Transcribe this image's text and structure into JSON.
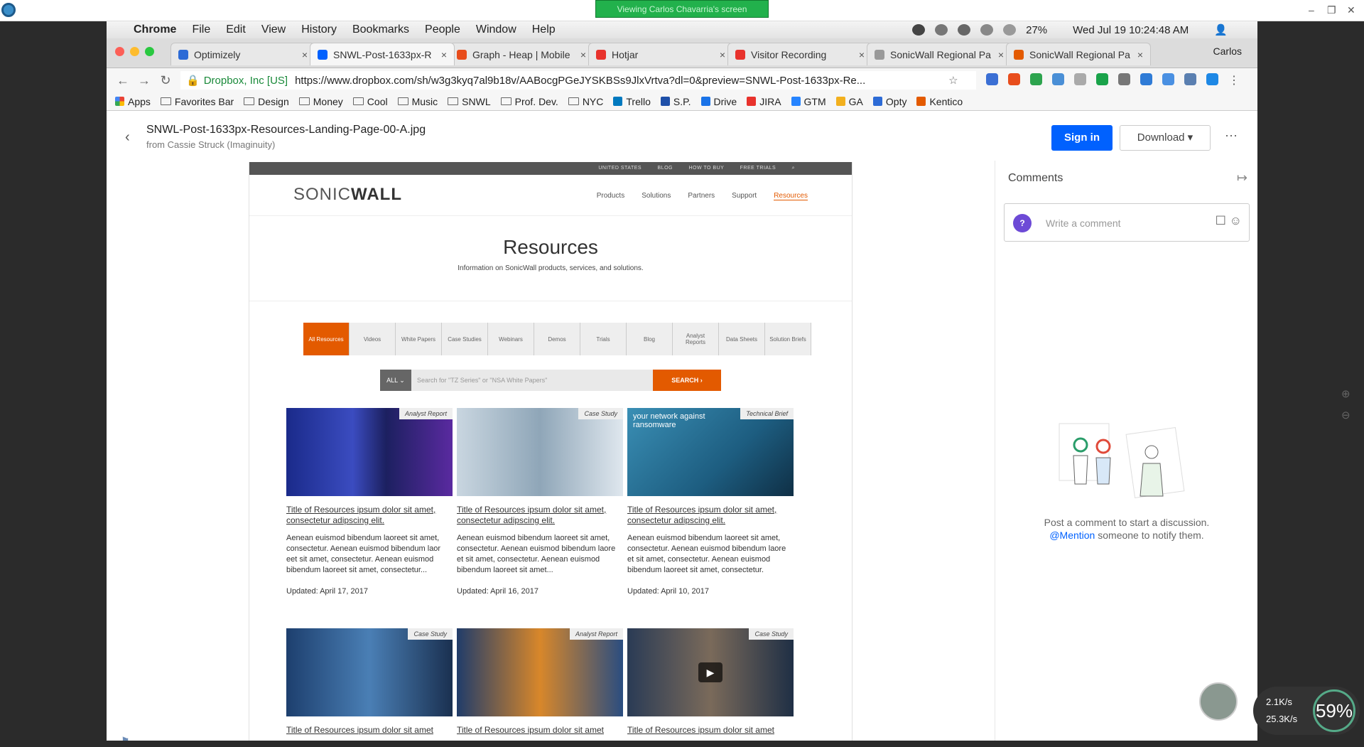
{
  "share_banner": "Viewing Carlos Chavarria's screen",
  "mac_menu": {
    "app": "Chrome",
    "items": [
      "File",
      "Edit",
      "View",
      "History",
      "Bookmarks",
      "People",
      "Window",
      "Help"
    ],
    "battery": "27%",
    "clock": "Wed Jul 19  10:24:48 AM"
  },
  "tabs": [
    {
      "title": "Optimizely",
      "color": "#2d6bd6"
    },
    {
      "title": "SNWL-Post-1633px-R",
      "color": "#0061fe"
    },
    {
      "title": "Graph - Heap | Mobile",
      "color": "#e84d1c"
    },
    {
      "title": "Hotjar",
      "color": "#e8322c"
    },
    {
      "title": "Visitor Recording",
      "color": "#e8322c"
    },
    {
      "title": "SonicWall Regional Pa",
      "color": "#999999"
    },
    {
      "title": "SonicWall Regional Pa",
      "color": "#e35a00"
    }
  ],
  "profile_name": "Carlos",
  "omnibox": {
    "secure_label": "Dropbox, Inc [US]",
    "url": "https://www.dropbox.com/sh/w3g3kyq7al9b18v/AABocgPGeJYSKBSs9JlxVrtva?dl=0&preview=SNWL-Post-1633px-Re..."
  },
  "bookmarks": [
    {
      "label": "Apps",
      "type": "apps"
    },
    {
      "label": "Favorites Bar",
      "type": "folder"
    },
    {
      "label": "Design",
      "type": "folder"
    },
    {
      "label": "Money",
      "type": "folder"
    },
    {
      "label": "Cool",
      "type": "folder"
    },
    {
      "label": "Music",
      "type": "folder"
    },
    {
      "label": "SNWL",
      "type": "folder"
    },
    {
      "label": "Prof. Dev.",
      "type": "folder"
    },
    {
      "label": "NYC",
      "type": "folder"
    },
    {
      "label": "Trello",
      "type": "link"
    },
    {
      "label": "S.P.",
      "type": "link"
    },
    {
      "label": "Drive",
      "type": "link"
    },
    {
      "label": "JIRA",
      "type": "link"
    },
    {
      "label": "GTM",
      "type": "link"
    },
    {
      "label": "GA",
      "type": "link"
    },
    {
      "label": "Opty",
      "type": "link"
    },
    {
      "label": "Kentico",
      "type": "link"
    }
  ],
  "file": {
    "name": "SNWL-Post-1633px-Resources-Landing-Page-00-A.jpg",
    "from": "from Cassie Struck (Imaginuity)"
  },
  "actions": {
    "signin": "Sign in",
    "download": "Download ▾",
    "more": "···"
  },
  "mock": {
    "util_links": [
      "UNITED STATES",
      "BLOG",
      "HOW TO BUY",
      "FREE TRIALS"
    ],
    "logo": {
      "part1": "SONIC",
      "part2": "WALL"
    },
    "nav": [
      "Products",
      "Solutions",
      "Partners",
      "Support",
      "Resources"
    ],
    "hero_title": "Resources",
    "hero_sub": "Information on SonicWall products, services, and solutions.",
    "filters": [
      "All Resources",
      "Videos",
      "White Papers",
      "Case Studies",
      "Webinars",
      "Demos",
      "Trials",
      "Blog",
      "Analyst Reports",
      "Data Sheets",
      "Solution Briefs"
    ],
    "search_scope": "ALL ⌄",
    "search_placeholder": "Search for \"TZ Series\" or \"NSA White Papers\"",
    "search_button": "SEARCH  ›",
    "cards": [
      {
        "tag": "Analyst Report",
        "title": "Title of Resources ipsum dolor sit amet, consectetur adipscing elit.",
        "body": "Aenean euismod bibendum laoreet sit amet, consectetur. Aenean euismod bibendum laor eet sit amet, consectetur. Aenean euismod bibendum laoreet sit amet, consectetur...",
        "date": "Updated: April 17, 2017"
      },
      {
        "tag": "Case Study",
        "title": "Title of Resources ipsum dolor sit amet, consectetur adipscing elit.",
        "body": "Aenean euismod bibendum laoreet sit amet, consectetur. Aenean euismod bibendum laore et sit amet, consectetur. Aenean euismod bibendum laoreet sit amet...",
        "date": "Updated: April 16, 2017"
      },
      {
        "tag": "Technical Brief",
        "title": "Title of Resources ipsum dolor sit amet, consectetur adipscing elit.",
        "body": "Aenean euismod bibendum laoreet sit amet, consectetur. Aenean euismod bibendum laore et sit amet, consectetur. Aenean euismod bibendum laoreet sit amet, consectetur.",
        "date": "Updated: April 10, 2017",
        "overlay": "your network against ransomware"
      },
      {
        "tag": "Case Study",
        "title": "Title of Resources ipsum dolor sit amet"
      },
      {
        "tag": "Analyst Report",
        "title": "Title of Resources ipsum dolor sit amet"
      },
      {
        "tag": "Case Study",
        "title": "Title of Resources ipsum dolor sit amet"
      }
    ]
  },
  "comments": {
    "heading": "Comments",
    "placeholder": "Write a comment",
    "empty_line1": "Post a comment to start a discussion.",
    "mention": "@Mention",
    "empty_line2": " someone to notify them."
  },
  "net": {
    "up": "2.1K/s",
    "down": "25.3K/s",
    "cpu": "59%"
  }
}
